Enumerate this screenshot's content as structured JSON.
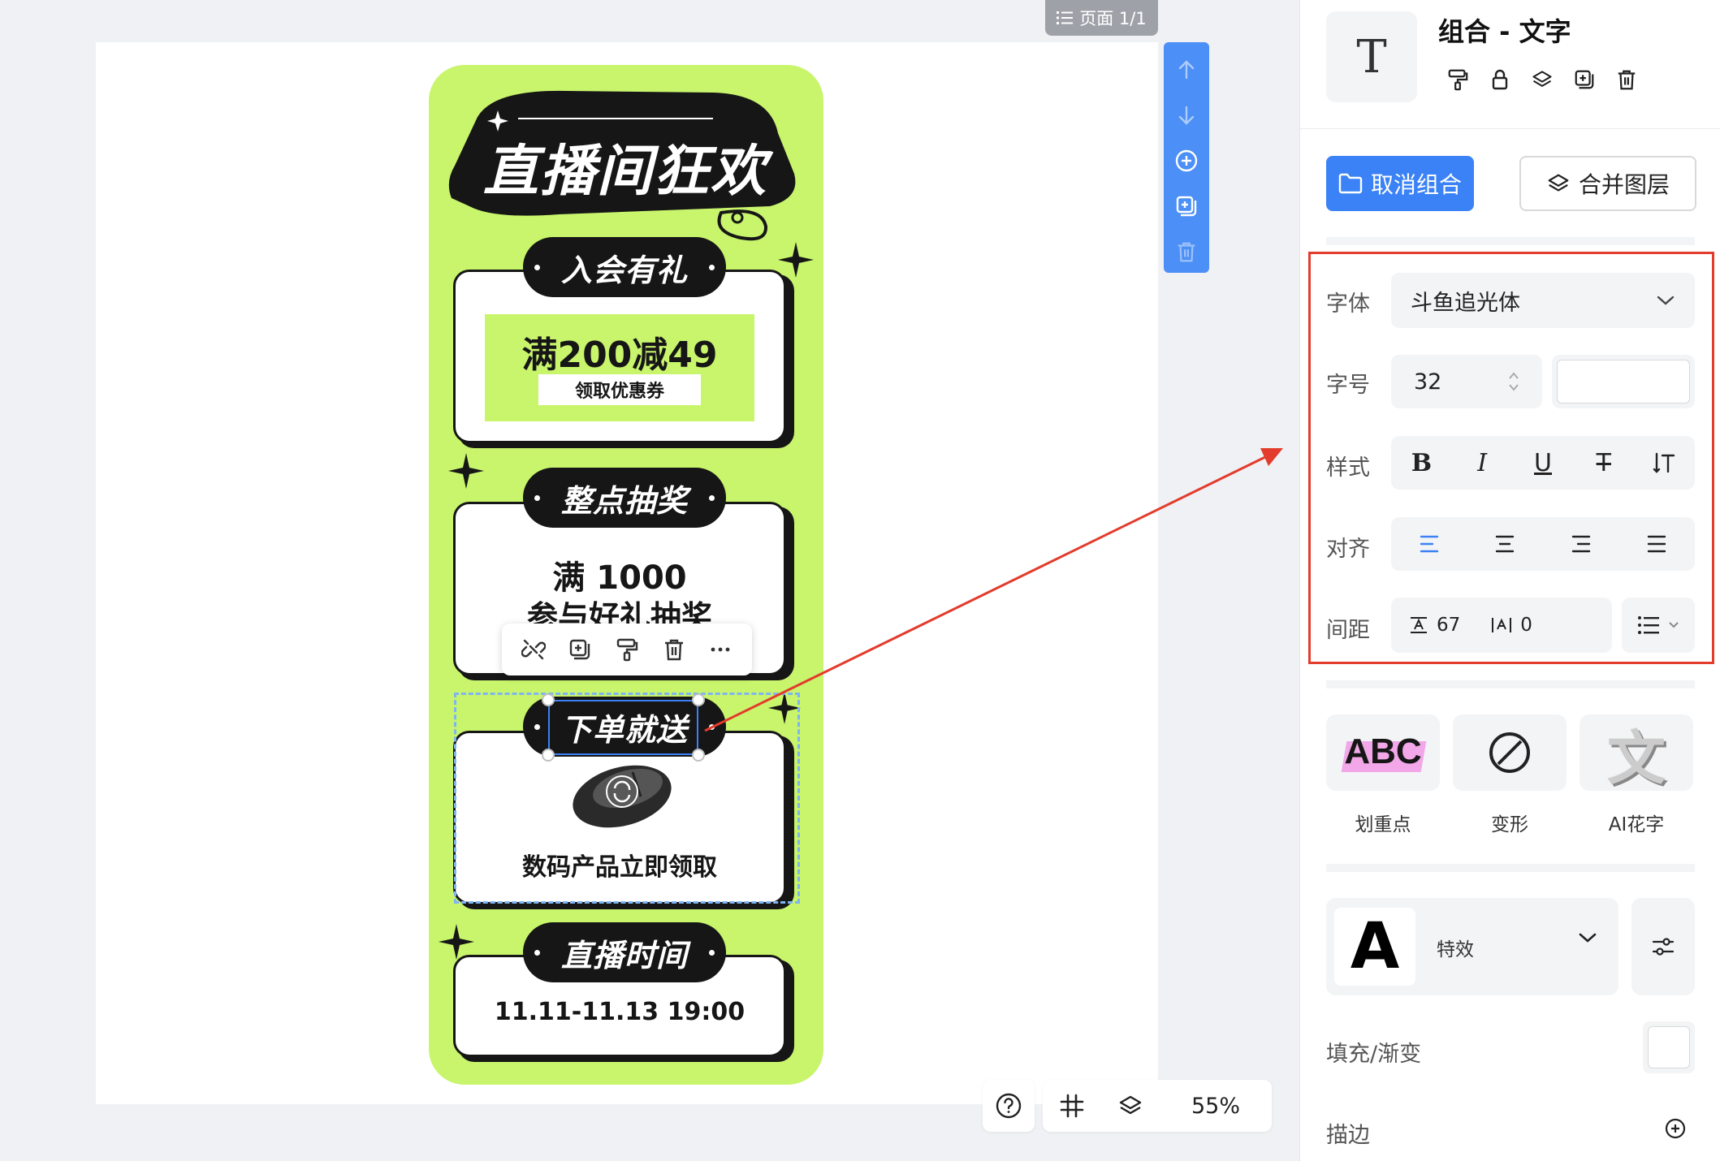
{
  "page_badge": "页面 1/1",
  "poster": {
    "headline": "直播间狂欢",
    "cards": [
      {
        "tag": "入会有礼",
        "coupon_main": "满200减49",
        "coupon_button": "领取优惠券"
      },
      {
        "tag": "整点抽奖",
        "line1": "满 1000",
        "line2": "参与好礼抽奖"
      },
      {
        "tag": "下单就送",
        "caption": "数码产品立即领取"
      },
      {
        "tag": "直播时间",
        "time": "11.11-11.13  19:00"
      }
    ],
    "colors": {
      "accent": "#c8f56c",
      "dark": "#161616"
    }
  },
  "float_toolbar": {
    "icons": [
      "unlink-icon",
      "copy-add-icon",
      "format-brush-icon",
      "trash-icon",
      "more-icon"
    ]
  },
  "layer_toolbar": {
    "icons": [
      "arrow-up-icon",
      "arrow-down-icon",
      "plus-circle-icon",
      "copy-add-icon",
      "trash-icon"
    ]
  },
  "bottom_bar": {
    "zoom": "55%",
    "icons": [
      "help-icon",
      "grid-icon",
      "layers-icon"
    ]
  },
  "panel": {
    "title": "组合 - 文字",
    "ungroup": "取消组合",
    "merge": "合并图层",
    "props": {
      "font_label": "字体",
      "font_value": "斗鱼追光体",
      "size_label": "字号",
      "size_value": "32",
      "style_label": "样式",
      "align_label": "对齐",
      "spacing_label": "间距",
      "line_spacing": "67",
      "letter_spacing": "0"
    },
    "effects": [
      {
        "label": "划重点",
        "icon": "highlight-abc-icon",
        "text": "ABC"
      },
      {
        "label": "变形",
        "icon": "forbidden-circle-icon"
      },
      {
        "label": "AI花字",
        "icon": "ai-wordart-icon",
        "text": "文"
      }
    ],
    "fx_label": "特效",
    "fx_preview": "A",
    "fill_label": "填充/渐变",
    "stroke_label": "描边",
    "colors": {
      "primary": "#3a82f5",
      "highlight_box": "#e33b2c"
    }
  }
}
